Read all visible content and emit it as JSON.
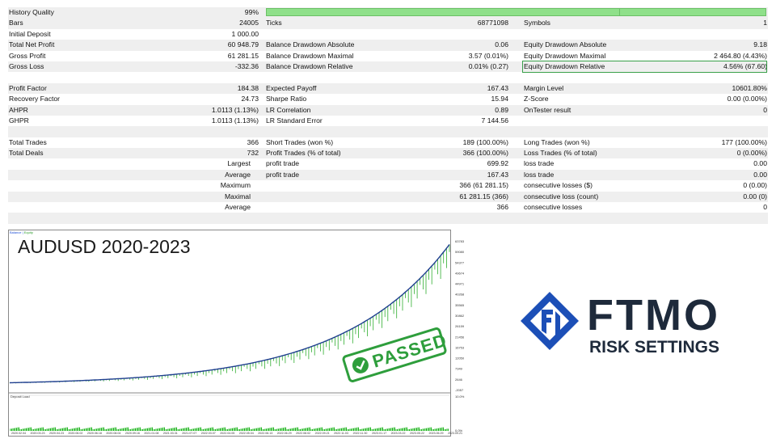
{
  "report": {
    "quality": {
      "label": "History Quality",
      "value": "99%"
    },
    "rows": [
      {
        "alt": true,
        "l1": "Bars",
        "v1": "24005",
        "l2": "Ticks",
        "v2": "68771098",
        "l3": "Symbols",
        "v3": "1"
      },
      {
        "alt": false,
        "l1": "Initial Deposit",
        "v1": "1 000.00",
        "l2": "",
        "v2": "",
        "l3": "",
        "v3": ""
      },
      {
        "alt": true,
        "l1": "Total Net Profit",
        "v1": "60 948.79",
        "l2": "Balance Drawdown Absolute",
        "v2": "0.06",
        "l3": "Equity Drawdown Absolute",
        "v3": "9.18"
      },
      {
        "alt": false,
        "l1": "Gross Profit",
        "v1": "61 281.15",
        "l2": "Balance Drawdown Maximal",
        "v2": "3.57 (0.01%)",
        "l3": "Equity Drawdown Maximal",
        "v3": "2 464.80 (4.43%)"
      },
      {
        "alt": true,
        "l1": "Gross Loss",
        "v1": "-332.36",
        "l2": "Balance Drawdown Relative",
        "v2": "0.01% (0.27)",
        "l3": "Equity Drawdown Relative",
        "v3": "4.56% (67.60)",
        "highlight": true
      },
      {
        "alt": false,
        "l1": "",
        "v1": "",
        "l2": "",
        "v2": "",
        "l3": "",
        "v3": ""
      },
      {
        "alt": true,
        "l1": "Profit Factor",
        "v1": "184.38",
        "l2": "Expected Payoff",
        "v2": "167.43",
        "l3": "Margin Level",
        "v3": "10601.80%"
      },
      {
        "alt": false,
        "l1": "Recovery Factor",
        "v1": "24.73",
        "l2": "Sharpe Ratio",
        "v2": "15.94",
        "l3": "Z-Score",
        "v3": "0.00 (0.00%)"
      },
      {
        "alt": true,
        "l1": "AHPR",
        "v1": "1.0113 (1.13%)",
        "l2": "LR Correlation",
        "v2": "0.89",
        "l3": "OnTester result",
        "v3": "0"
      },
      {
        "alt": false,
        "l1": "GHPR",
        "v1": "1.0113 (1.13%)",
        "l2": "LR Standard Error",
        "v2": "7 144.56",
        "l3": "",
        "v3": ""
      },
      {
        "alt": true,
        "l1": "",
        "v1": "",
        "l2": "",
        "v2": "",
        "l3": "",
        "v3": ""
      },
      {
        "alt": false,
        "l1": "Total Trades",
        "v1": "366",
        "l2": "Short Trades (won %)",
        "v2": "189 (100.00%)",
        "l3": "Long Trades (won %)",
        "v3": "177 (100.00%)"
      },
      {
        "alt": true,
        "l1": "Total Deals",
        "v1": "732",
        "l2": "Profit Trades (% of total)",
        "v2": "366 (100.00%)",
        "l3": "Loss Trades (% of total)",
        "v3": "0 (0.00%)"
      },
      {
        "alt": false,
        "r1": "Largest",
        "l2": "profit trade",
        "v2": "699.92",
        "l3": "loss trade",
        "v3": "0.00"
      },
      {
        "alt": true,
        "r1": "Average",
        "l2": "profit trade",
        "v2": "167.43",
        "l3": "loss trade",
        "v3": "0.00"
      },
      {
        "alt": false,
        "r1": "Maximum",
        "l2": "",
        "v2": "366 (61 281.15)",
        "l3": "consecutive losses ($)",
        "v3": "0 (0.00)"
      },
      {
        "alt": true,
        "r1": "Maximal",
        "l2": "",
        "v2": "61 281.15 (366)",
        "l3": "consecutive loss (count)",
        "v3": "0.00 (0)"
      },
      {
        "alt": false,
        "r1": "Average",
        "l2": "",
        "v2": "366",
        "l3": "consecutive losses",
        "v3": "0"
      },
      {
        "alt": true,
        "l1": "",
        "v1": "",
        "l2": "",
        "v2": "",
        "l3": "",
        "v3": ""
      }
    ]
  },
  "chart": {
    "title": "AUDUSD 2020-2023",
    "legend": {
      "balance": "Balance",
      "equity": "Equity"
    },
    "deposit_load_label": "Deposit Load",
    "y_ticks": [
      "63783",
      "59080",
      "54377",
      "49674",
      "44971",
      "40268",
      "35565",
      "30862",
      "26159",
      "21456",
      "16753",
      "12050",
      "7349",
      "2646",
      "-2057"
    ],
    "x_ticks": [
      "2020.02.04",
      "2020.03.23",
      "2020.04.23",
      "2020.06.02",
      "2020.06.18",
      "2020.08.04",
      "2020.09.16",
      "2021.01.08",
      "2021.03.31",
      "2021.07.07",
      "2022.03.07",
      "2022.04.05",
      "2022.05.04",
      "2022.06.13",
      "2022.06.29",
      "2022.08.02",
      "2022.09.21",
      "2022.11.03",
      "2022.11.30",
      "2023.01.17",
      "2023.03.22",
      "2023.05.22",
      "2023.06.29",
      "2023.09.21"
    ],
    "load_ticks": [
      "10.0%",
      "0.0%"
    ],
    "stamp": "PASSED",
    "colors": {
      "balance": "#1f3f8f",
      "equity": "#2fae2f",
      "stamp": "#2e9e3c",
      "load": "#1fb51f"
    }
  },
  "brand": {
    "name": "FTMO",
    "subtitle": "RISK SETTINGS",
    "colors": {
      "logo_blue": "#1c4fb7",
      "text": "#1e2a3b"
    }
  }
}
